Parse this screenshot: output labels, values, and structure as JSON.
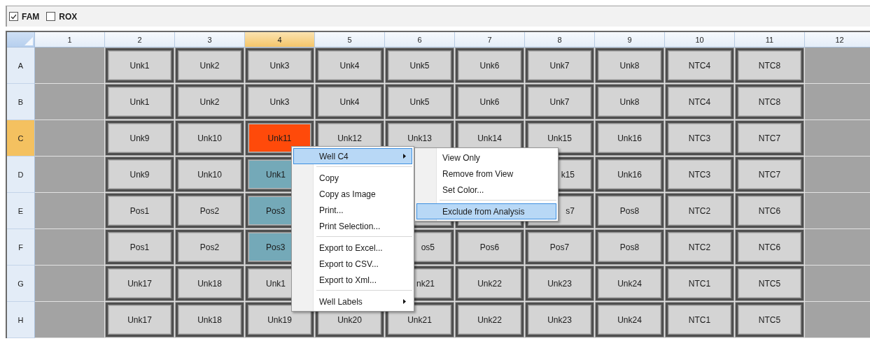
{
  "channels": [
    {
      "label": "FAM",
      "checked": true
    },
    {
      "label": "ROX",
      "checked": false
    }
  ],
  "plate": {
    "columns": [
      {
        "label": "1",
        "selected": false
      },
      {
        "label": "2",
        "selected": false
      },
      {
        "label": "3",
        "selected": false
      },
      {
        "label": "4",
        "selected": true
      },
      {
        "label": "5",
        "selected": false
      },
      {
        "label": "6",
        "selected": false
      },
      {
        "label": "7",
        "selected": false
      },
      {
        "label": "8",
        "selected": false
      },
      {
        "label": "9",
        "selected": false
      },
      {
        "label": "10",
        "selected": false
      },
      {
        "label": "11",
        "selected": false
      },
      {
        "label": "12",
        "selected": false
      }
    ],
    "rows": [
      {
        "label": "A",
        "selected": false,
        "wells": [
          {
            "kind": "empty"
          },
          {
            "kind": "well",
            "selected": false,
            "highlighted": false,
            "label": "Unk1"
          },
          {
            "kind": "well",
            "selected": false,
            "highlighted": false,
            "label": "Unk2"
          },
          {
            "kind": "well",
            "selected": false,
            "highlighted": false,
            "label": "Unk3"
          },
          {
            "kind": "well",
            "selected": false,
            "highlighted": false,
            "label": "Unk4"
          },
          {
            "kind": "well",
            "selected": false,
            "highlighted": false,
            "label": "Unk5"
          },
          {
            "kind": "well",
            "selected": false,
            "highlighted": false,
            "label": "Unk6"
          },
          {
            "kind": "well",
            "selected": false,
            "highlighted": false,
            "label": "Unk7"
          },
          {
            "kind": "well",
            "selected": false,
            "highlighted": false,
            "label": "Unk8"
          },
          {
            "kind": "well",
            "selected": false,
            "highlighted": false,
            "label": "NTC4"
          },
          {
            "kind": "well",
            "selected": false,
            "highlighted": false,
            "label": "NTC8"
          },
          {
            "kind": "empty"
          }
        ]
      },
      {
        "label": "B",
        "selected": false,
        "wells": [
          {
            "kind": "empty"
          },
          {
            "kind": "well",
            "selected": false,
            "highlighted": false,
            "label": "Unk1"
          },
          {
            "kind": "well",
            "selected": false,
            "highlighted": false,
            "label": "Unk2"
          },
          {
            "kind": "well",
            "selected": false,
            "highlighted": false,
            "label": "Unk3"
          },
          {
            "kind": "well",
            "selected": false,
            "highlighted": false,
            "label": "Unk4"
          },
          {
            "kind": "well",
            "selected": false,
            "highlighted": false,
            "label": "Unk5"
          },
          {
            "kind": "well",
            "selected": false,
            "highlighted": false,
            "label": "Unk6"
          },
          {
            "kind": "well",
            "selected": false,
            "highlighted": false,
            "label": "Unk7"
          },
          {
            "kind": "well",
            "selected": false,
            "highlighted": false,
            "label": "Unk8"
          },
          {
            "kind": "well",
            "selected": false,
            "highlighted": false,
            "label": "NTC4"
          },
          {
            "kind": "well",
            "selected": false,
            "highlighted": false,
            "label": "NTC8"
          },
          {
            "kind": "empty"
          }
        ]
      },
      {
        "label": "C",
        "selected": true,
        "wells": [
          {
            "kind": "empty"
          },
          {
            "kind": "well",
            "selected": false,
            "highlighted": false,
            "label": "Unk9"
          },
          {
            "kind": "well",
            "selected": false,
            "highlighted": false,
            "label": "Unk10"
          },
          {
            "kind": "well",
            "selected": true,
            "label": "Unk11"
          },
          {
            "kind": "well",
            "selected": false,
            "highlighted": false,
            "label": "Unk12"
          },
          {
            "kind": "well",
            "selected": false,
            "highlighted": false,
            "label": "Unk13"
          },
          {
            "kind": "well",
            "selected": false,
            "highlighted": false,
            "label": "Unk14"
          },
          {
            "kind": "well",
            "selected": false,
            "highlighted": false,
            "label": "Unk15"
          },
          {
            "kind": "well",
            "selected": false,
            "highlighted": false,
            "label": "Unk16"
          },
          {
            "kind": "well",
            "selected": false,
            "highlighted": false,
            "label": "NTC3"
          },
          {
            "kind": "well",
            "selected": false,
            "highlighted": false,
            "label": "NTC7"
          },
          {
            "kind": "empty"
          }
        ]
      },
      {
        "label": "D",
        "selected": false,
        "wells": [
          {
            "kind": "empty"
          },
          {
            "kind": "well",
            "selected": false,
            "highlighted": false,
            "label": "Unk9"
          },
          {
            "kind": "well",
            "selected": false,
            "highlighted": false,
            "label": "Unk10"
          },
          {
            "kind": "head",
            "selected": false,
            "highlighted": true,
            "label": "Unk1"
          },
          {
            "kind": "hidden"
          },
          {
            "kind": "hidden"
          },
          {
            "kind": "hidden"
          },
          {
            "kind": "tail",
            "selected": false,
            "highlighted": false,
            "label": "k15"
          },
          {
            "kind": "well",
            "selected": false,
            "highlighted": false,
            "label": "Unk16"
          },
          {
            "kind": "well",
            "selected": false,
            "highlighted": false,
            "label": "NTC3"
          },
          {
            "kind": "well",
            "selected": false,
            "highlighted": false,
            "label": "NTC7"
          },
          {
            "kind": "empty"
          }
        ]
      },
      {
        "label": "E",
        "selected": false,
        "wells": [
          {
            "kind": "empty"
          },
          {
            "kind": "well",
            "selected": false,
            "highlighted": false,
            "label": "Pos1"
          },
          {
            "kind": "well",
            "selected": false,
            "highlighted": false,
            "label": "Pos2"
          },
          {
            "kind": "head",
            "selected": false,
            "highlighted": true,
            "label": "Pos3"
          },
          {
            "kind": "hidden"
          },
          {
            "kind": "blank"
          },
          {
            "kind": "blank"
          },
          {
            "kind": "tail",
            "selected": false,
            "highlighted": false,
            "label": "s7"
          },
          {
            "kind": "well",
            "selected": false,
            "highlighted": false,
            "label": "Pos8"
          },
          {
            "kind": "well",
            "selected": false,
            "highlighted": false,
            "label": "NTC2"
          },
          {
            "kind": "well",
            "selected": false,
            "highlighted": false,
            "label": "NTC6"
          },
          {
            "kind": "empty"
          }
        ]
      },
      {
        "label": "F",
        "selected": false,
        "wells": [
          {
            "kind": "empty"
          },
          {
            "kind": "well",
            "selected": false,
            "highlighted": false,
            "label": "Pos1"
          },
          {
            "kind": "well",
            "selected": false,
            "highlighted": false,
            "label": "Pos2"
          },
          {
            "kind": "head",
            "selected": false,
            "highlighted": true,
            "label": "Pos3"
          },
          {
            "kind": "hidden"
          },
          {
            "kind": "tail",
            "selected": false,
            "highlighted": false,
            "label": "os5"
          },
          {
            "kind": "well",
            "selected": false,
            "highlighted": false,
            "label": "Pos6"
          },
          {
            "kind": "well",
            "selected": false,
            "highlighted": false,
            "label": "Pos7"
          },
          {
            "kind": "well",
            "selected": false,
            "highlighted": false,
            "label": "Pos8"
          },
          {
            "kind": "well",
            "selected": false,
            "highlighted": false,
            "label": "NTC2"
          },
          {
            "kind": "well",
            "selected": false,
            "highlighted": false,
            "label": "NTC6"
          },
          {
            "kind": "empty"
          }
        ]
      },
      {
        "label": "G",
        "selected": false,
        "wells": [
          {
            "kind": "empty"
          },
          {
            "kind": "well",
            "selected": false,
            "highlighted": false,
            "label": "Unk17"
          },
          {
            "kind": "well",
            "selected": false,
            "highlighted": false,
            "label": "Unk18"
          },
          {
            "kind": "head",
            "selected": false,
            "highlighted": false,
            "label": "Unk1"
          },
          {
            "kind": "hidden"
          },
          {
            "kind": "tail",
            "selected": false,
            "highlighted": false,
            "label": "nk21"
          },
          {
            "kind": "well",
            "selected": false,
            "highlighted": false,
            "label": "Unk22"
          },
          {
            "kind": "well",
            "selected": false,
            "highlighted": false,
            "label": "Unk23"
          },
          {
            "kind": "well",
            "selected": false,
            "highlighted": false,
            "label": "Unk24"
          },
          {
            "kind": "well",
            "selected": false,
            "highlighted": false,
            "label": "NTC1"
          },
          {
            "kind": "well",
            "selected": false,
            "highlighted": false,
            "label": "NTC5"
          },
          {
            "kind": "empty"
          }
        ]
      },
      {
        "label": "H",
        "selected": false,
        "wells": [
          {
            "kind": "empty"
          },
          {
            "kind": "well",
            "selected": false,
            "highlighted": false,
            "label": "Unk17"
          },
          {
            "kind": "well",
            "selected": false,
            "highlighted": false,
            "label": "Unk18"
          },
          {
            "kind": "well",
            "selected": false,
            "highlighted": false,
            "label": "Unk19"
          },
          {
            "kind": "well",
            "selected": false,
            "highlighted": false,
            "label": "Unk20"
          },
          {
            "kind": "well",
            "selected": false,
            "highlighted": false,
            "label": "Unk21"
          },
          {
            "kind": "well",
            "selected": false,
            "highlighted": false,
            "label": "Unk22"
          },
          {
            "kind": "well",
            "selected": false,
            "highlighted": false,
            "label": "Unk23"
          },
          {
            "kind": "well",
            "selected": false,
            "highlighted": false,
            "label": "Unk24"
          },
          {
            "kind": "well",
            "selected": false,
            "highlighted": false,
            "label": "NTC1"
          },
          {
            "kind": "well",
            "selected": false,
            "highlighted": false,
            "label": "NTC5"
          },
          {
            "kind": "empty"
          }
        ]
      }
    ]
  },
  "context_menu": {
    "items": [
      {
        "kind": "item",
        "label": "Well C4",
        "submenu": true,
        "selected": true
      },
      {
        "kind": "separator"
      },
      {
        "kind": "item",
        "label": "Copy",
        "submenu": false,
        "selected": false
      },
      {
        "kind": "item",
        "label": "Copy as Image",
        "submenu": false,
        "selected": false
      },
      {
        "kind": "item",
        "label": "Print...",
        "submenu": false,
        "selected": false
      },
      {
        "kind": "item",
        "label": "Print Selection...",
        "submenu": false,
        "selected": false
      },
      {
        "kind": "separator"
      },
      {
        "kind": "item",
        "label": "Export to Excel...",
        "submenu": false,
        "selected": false
      },
      {
        "kind": "item",
        "label": "Export to CSV...",
        "submenu": false,
        "selected": false
      },
      {
        "kind": "item",
        "label": "Export to Xml...",
        "submenu": false,
        "selected": false
      },
      {
        "kind": "separator"
      },
      {
        "kind": "item",
        "label": "Well Labels",
        "submenu": true,
        "selected": false
      }
    ]
  },
  "submenu": {
    "items": [
      {
        "kind": "item",
        "label": "View Only",
        "selected": false
      },
      {
        "kind": "item",
        "label": "Remove from View",
        "selected": false
      },
      {
        "kind": "item",
        "label": "Set Color...",
        "selected": false
      },
      {
        "kind": "separator"
      },
      {
        "kind": "item",
        "label": "Exclude from Analysis",
        "selected": true
      }
    ]
  }
}
